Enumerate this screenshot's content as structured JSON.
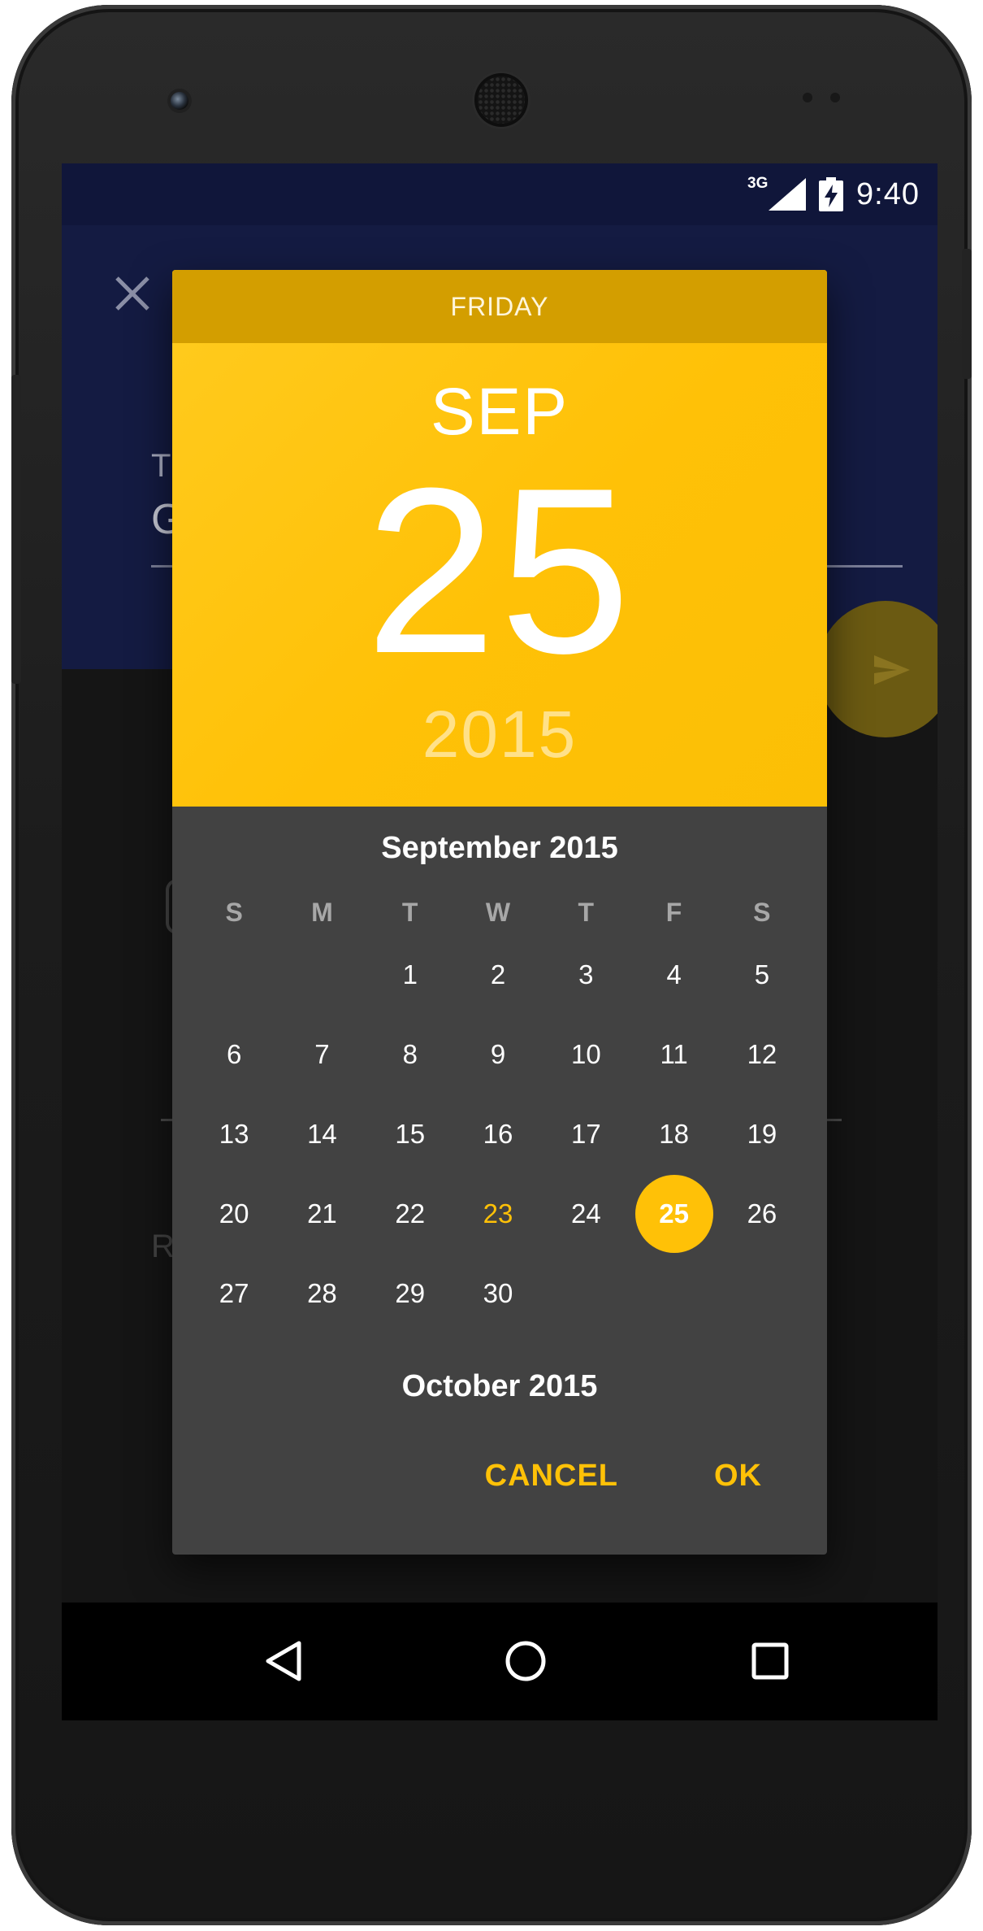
{
  "status_bar": {
    "network_label": "3G",
    "time": "9:40",
    "icons": [
      "signal-icon",
      "battery-charging-icon"
    ]
  },
  "background_app": {
    "close_icon": "close-icon",
    "title_label": "T",
    "title_value": "G",
    "faded_text": "R",
    "fab_icon": "send-icon"
  },
  "date_picker": {
    "header": {
      "day_name": "FRIDAY",
      "month": "SEP",
      "day": "25",
      "year": "2015"
    },
    "month_title": "September 2015",
    "weekdays": [
      "S",
      "M",
      "T",
      "W",
      "T",
      "F",
      "S"
    ],
    "days": [
      "",
      "",
      "1",
      "2",
      "3",
      "4",
      "5",
      "6",
      "7",
      "8",
      "9",
      "10",
      "11",
      "12",
      "13",
      "14",
      "15",
      "16",
      "17",
      "18",
      "19",
      "20",
      "21",
      "22",
      "23",
      "24",
      "25",
      "26",
      "27",
      "28",
      "29",
      "30"
    ],
    "today": "23",
    "selected": "25",
    "next_month_title": "October 2015",
    "cancel_label": "CANCEL",
    "ok_label": "OK"
  },
  "colors": {
    "accent": "#ffc107",
    "dialog_bg": "#424242",
    "header_dark": "#d39e00",
    "app_header": "#141b42"
  },
  "nav_bar": {
    "icons": [
      "back-icon",
      "home-icon",
      "recents-icon"
    ]
  }
}
